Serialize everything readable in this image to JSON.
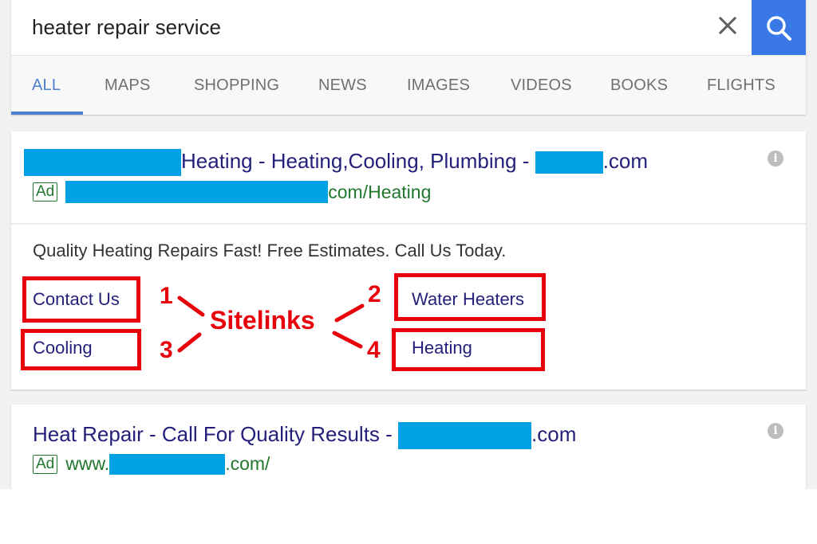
{
  "search": {
    "query": "heater repair service",
    "clear_icon": "close-icon",
    "search_icon": "search-icon",
    "accent_color": "#3b78e7"
  },
  "tabs": [
    {
      "label": "ALL",
      "active": true
    },
    {
      "label": "MAPS",
      "active": false
    },
    {
      "label": "SHOPPING",
      "active": false
    },
    {
      "label": "NEWS",
      "active": false
    },
    {
      "label": "IMAGES",
      "active": false
    },
    {
      "label": "VIDEOS",
      "active": false
    },
    {
      "label": "BOOKS",
      "active": false
    },
    {
      "label": "FLIGHTS",
      "active": false
    }
  ],
  "ads": [
    {
      "title_suffix": "Heating - Heating,Cooling, Plumbing - ",
      "title_tld": ".com",
      "badge": "Ad",
      "url_suffix": "com/Heating",
      "description": "Quality Heating Repairs Fast! Free Estimates. Call Us Today.",
      "sitelinks": [
        "Contact Us",
        "Water Heaters",
        "Cooling",
        "Heating"
      ],
      "info_icon": "i"
    },
    {
      "title_prefix": "Heat Repair - Call For Quality Results - ",
      "title_tld": ".com",
      "badge": "Ad",
      "url_prefix": "www.",
      "url_suffix": ".com/",
      "info_icon": "i"
    }
  ],
  "annotation": {
    "label": "Sitelinks",
    "numbers": [
      "1",
      "2",
      "3",
      "4"
    ],
    "color": "#e8000b"
  },
  "redaction_color": "#00a1e4"
}
